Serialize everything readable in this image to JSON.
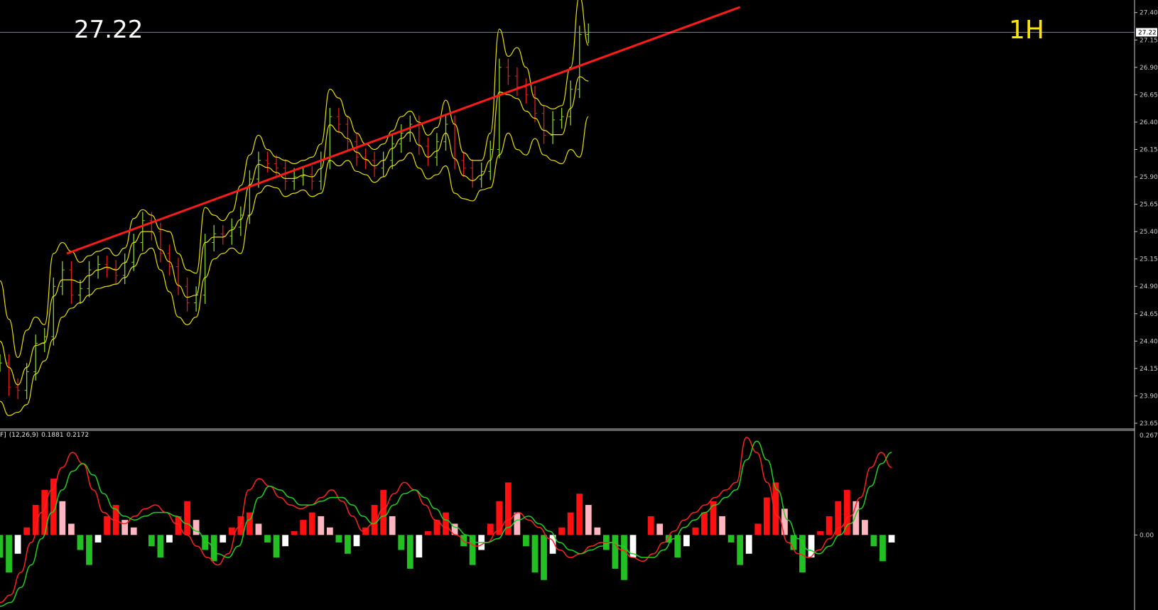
{
  "overlay": {
    "last_price": "27.22",
    "timeframe": "1H"
  },
  "colors": {
    "background": "#000000",
    "axis": "#c8c8c8",
    "bollinger": "#e8e000",
    "trendline": "#ff1a1a",
    "candle_up": "#8bd12a",
    "candle_down": "#e01b1b",
    "hist_pos_strong": "#ff1010",
    "hist_pos_weak": "#ffb6c1",
    "hist_neg_strong": "#22c022",
    "hist_neg_weak": "#ffffff",
    "macd_line": "#ff2020",
    "signal_line": "#20d020"
  },
  "price_axis": {
    "ticks": [
      "27.40",
      "27.15",
      "26.90",
      "26.65",
      "26.40",
      "26.15",
      "25.90",
      "25.65",
      "25.40",
      "25.15",
      "24.90",
      "24.65",
      "24.40",
      "24.15",
      "23.90",
      "23.65"
    ],
    "current_label": "27.22"
  },
  "macd_panel": {
    "label_prefix": "F]",
    "params": "(12,26,9)",
    "value1": "0.1881",
    "value2": "0.2172",
    "axis_ticks": [
      "0.2675",
      "0.00"
    ]
  },
  "chart_data": [
    {
      "type": "line",
      "title": "",
      "y_range": [
        23.65,
        27.45
      ],
      "y_scale": "linear",
      "grid": false,
      "x": [
        0,
        1,
        2,
        3,
        4,
        5,
        6,
        7,
        8,
        9,
        10,
        11,
        12,
        13,
        14,
        15,
        16,
        17,
        18,
        19,
        20,
        21,
        22,
        23,
        24,
        25,
        26,
        27,
        28,
        29,
        30,
        31,
        32,
        33,
        34,
        35,
        36,
        37,
        38,
        39,
        40,
        41,
        42,
        43,
        44,
        45,
        46,
        47,
        48,
        49,
        50,
        51,
        52,
        53,
        54,
        55,
        56,
        57,
        58,
        59,
        60,
        61,
        62,
        63,
        64,
        65,
        66,
        67,
        68,
        69,
        70,
        71,
        72,
        73,
        74,
        75,
        76,
        77,
        78,
        79,
        80,
        81,
        82,
        83,
        84,
        85,
        86,
        87,
        88,
        89,
        90,
        91,
        92,
        93,
        94,
        95,
        96,
        97,
        98,
        99,
        100
      ],
      "series": [
        {
          "name": "",
          "role": "close",
          "values": [
            24.2,
            23.98,
            23.95,
            24.12,
            24.38,
            24.44,
            24.9,
            25.05,
            24.82,
            24.88,
            25.05,
            25.1,
            25.06,
            25.0,
            25.12,
            25.3,
            25.5,
            25.4,
            25.2,
            25.08,
            24.9,
            24.75,
            24.82,
            25.3,
            25.38,
            25.36,
            25.44,
            25.55,
            25.88,
            26.05,
            26.02,
            25.98,
            25.86,
            25.9,
            25.92,
            25.86,
            26.05,
            26.45,
            26.38,
            26.22,
            26.08,
            26.05,
            25.98,
            26.05,
            26.2,
            26.3,
            26.38,
            26.18,
            26.08,
            26.22,
            26.38,
            26.05,
            25.98,
            25.88,
            25.95,
            26.15,
            26.9,
            26.82,
            26.72,
            26.65,
            26.48,
            26.28,
            26.42,
            26.45,
            26.7,
            27.2,
            27.22
          ]
        },
        {
          "name": "",
          "role": "bollinger-upper",
          "values": [
            24.95,
            24.6,
            24.25,
            24.5,
            24.62,
            24.55,
            25.2,
            25.3,
            25.22,
            25.12,
            25.18,
            25.22,
            25.25,
            25.18,
            25.25,
            25.52,
            25.6,
            25.55,
            25.42,
            25.4,
            25.2,
            25.05,
            25.02,
            25.62,
            25.55,
            25.5,
            25.58,
            25.82,
            26.1,
            26.28,
            26.15,
            26.08,
            26.05,
            26.02,
            26.05,
            26.08,
            26.2,
            26.7,
            26.62,
            26.45,
            26.3,
            26.2,
            26.15,
            26.2,
            26.32,
            26.45,
            26.5,
            26.4,
            26.28,
            26.35,
            26.6,
            26.38,
            26.12,
            26.05,
            26.05,
            26.3,
            27.25,
            27.0,
            27.08,
            26.9,
            26.62,
            26.55,
            26.52,
            26.55,
            26.9,
            27.55,
            27.1
          ]
        },
        {
          "name": "",
          "role": "bollinger-lower",
          "values": [
            23.85,
            23.72,
            23.75,
            23.82,
            24.1,
            24.22,
            24.42,
            24.62,
            24.7,
            24.75,
            24.82,
            24.88,
            24.9,
            24.92,
            24.98,
            25.08,
            25.2,
            25.25,
            25.05,
            24.85,
            24.62,
            24.55,
            24.62,
            24.98,
            25.15,
            25.2,
            25.25,
            25.2,
            25.55,
            25.75,
            25.82,
            25.8,
            25.72,
            25.75,
            25.78,
            25.72,
            25.75,
            26.05,
            26.0,
            26.05,
            25.95,
            25.92,
            25.85,
            25.9,
            26.0,
            26.05,
            26.12,
            25.98,
            25.88,
            25.92,
            26.0,
            25.75,
            25.7,
            25.68,
            25.78,
            25.8,
            26.1,
            26.3,
            26.15,
            26.1,
            26.25,
            26.1,
            26.05,
            26.02,
            26.15,
            26.08,
            26.45
          ]
        },
        {
          "name": "",
          "role": "trendline",
          "x_points": [
            7.5,
            83
          ],
          "values": [
            25.2,
            27.45
          ]
        }
      ]
    },
    {
      "type": "bar",
      "title": "",
      "y_range": [
        -0.2,
        0.2675
      ],
      "series": [
        {
          "name": "",
          "role": "macd-histogram",
          "values": [
            -0.06,
            -0.1,
            -0.05,
            0.02,
            0.08,
            0.12,
            0.15,
            0.09,
            0.03,
            -0.04,
            -0.08,
            -0.02,
            0.05,
            0.08,
            0.04,
            0.02,
            0.0,
            -0.03,
            -0.06,
            -0.02,
            0.05,
            0.09,
            0.04,
            -0.04,
            -0.07,
            -0.02,
            0.02,
            0.05,
            0.06,
            0.03,
            -0.02,
            -0.06,
            -0.03,
            0.01,
            0.04,
            0.06,
            0.05,
            0.02,
            -0.02,
            -0.05,
            -0.03,
            0.02,
            0.08,
            0.12,
            0.05,
            -0.04,
            -0.09,
            -0.06,
            0.01,
            0.04,
            0.06,
            0.03,
            -0.03,
            -0.08,
            -0.04,
            0.03,
            0.09,
            0.14,
            0.06,
            -0.03,
            -0.1,
            -0.12,
            -0.05,
            0.02,
            0.06,
            0.11,
            0.08,
            0.02,
            -0.04,
            -0.09,
            -0.12,
            -0.06,
            0.0,
            0.05,
            0.03,
            -0.02,
            -0.06,
            -0.03,
            0.02,
            0.06,
            0.09,
            0.05,
            -0.02,
            -0.08,
            -0.05,
            0.03,
            0.1,
            0.14,
            0.07,
            -0.04,
            -0.1,
            -0.06,
            0.01,
            0.05,
            0.09,
            0.12,
            0.09,
            0.04,
            -0.03,
            -0.07,
            -0.02
          ]
        },
        {
          "name": "",
          "role": "macd-line",
          "values": [
            -0.18,
            -0.16,
            -0.1,
            -0.02,
            0.06,
            0.12,
            0.18,
            0.22,
            0.19,
            0.12,
            0.06,
            0.04,
            0.03,
            0.05,
            0.07,
            0.08,
            0.06,
            0.03,
            0.0,
            -0.03,
            -0.06,
            -0.08,
            -0.05,
            0.02,
            0.12,
            0.15,
            0.13,
            0.1,
            0.08,
            0.07,
            0.08,
            0.1,
            0.12,
            0.09,
            0.05,
            0.01,
            0.03,
            0.07,
            0.11,
            0.14,
            0.12,
            0.08,
            0.04,
            0.02,
            0.0,
            -0.02,
            -0.03,
            -0.02,
            0.01,
            0.04,
            0.06,
            0.04,
            0.02,
            -0.01,
            -0.04,
            -0.06,
            -0.05,
            -0.03,
            -0.02,
            -0.02,
            -0.04,
            -0.06,
            -0.07,
            -0.05,
            -0.02,
            0.01,
            0.04,
            0.06,
            0.08,
            0.1,
            0.12,
            0.14,
            0.26,
            0.22,
            0.14,
            0.05,
            -0.02,
            -0.05,
            -0.06,
            -0.04,
            -0.01,
            0.02,
            0.05,
            0.1,
            0.18,
            0.22,
            0.18
          ]
        },
        {
          "name": "",
          "role": "signal-line",
          "values": [
            -0.19,
            -0.18,
            -0.14,
            -0.08,
            -0.01,
            0.06,
            0.12,
            0.17,
            0.19,
            0.16,
            0.11,
            0.07,
            0.05,
            0.04,
            0.05,
            0.06,
            0.06,
            0.05,
            0.03,
            0.01,
            -0.02,
            -0.05,
            -0.06,
            -0.03,
            0.04,
            0.1,
            0.13,
            0.12,
            0.1,
            0.08,
            0.08,
            0.09,
            0.1,
            0.1,
            0.08,
            0.05,
            0.03,
            0.05,
            0.08,
            0.11,
            0.12,
            0.1,
            0.07,
            0.04,
            0.02,
            0.0,
            -0.02,
            -0.02,
            -0.01,
            0.02,
            0.04,
            0.05,
            0.03,
            0.01,
            -0.02,
            -0.04,
            -0.05,
            -0.04,
            -0.03,
            -0.02,
            -0.03,
            -0.05,
            -0.06,
            -0.06,
            -0.04,
            -0.01,
            0.02,
            0.04,
            0.06,
            0.08,
            0.1,
            0.12,
            0.2,
            0.25,
            0.2,
            0.12,
            0.04,
            -0.01,
            -0.04,
            -0.05,
            -0.03,
            0.0,
            0.03,
            0.07,
            0.13,
            0.19,
            0.22
          ]
        }
      ]
    }
  ]
}
